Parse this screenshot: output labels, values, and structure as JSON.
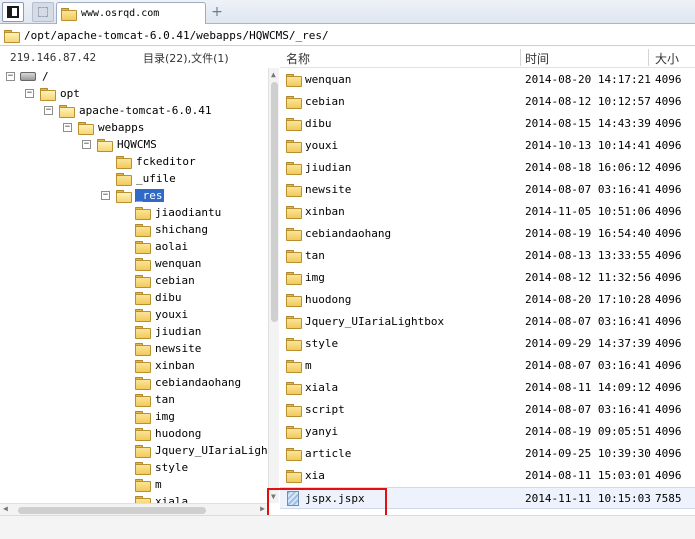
{
  "tabbar": {
    "active_tab_label": "www.osrqd.com",
    "new_tab_label": "+"
  },
  "pathbar": {
    "path": "/opt/apache-tomcat-6.0.41/webapps/HQWCMS/_res/"
  },
  "left_panel": {
    "host_ip": "219.146.87.42",
    "count_label": "目录(22),文件(1)"
  },
  "tree": {
    "root": "/",
    "opt": "opt",
    "tomcat": "apache-tomcat-6.0.41",
    "webapps": "webapps",
    "hqwcms": "HQWCMS",
    "fckeditor": "fckeditor",
    "ufile": "_ufile",
    "res": "_res",
    "res_children": [
      "jiaodiantu",
      "shichang",
      "aolai",
      "wenquan",
      "cebian",
      "dibu",
      "youxi",
      "jiudian",
      "newsite",
      "xinban",
      "cebiandaohang",
      "tan",
      "img",
      "huodong",
      "Jquery_UIariaLightb",
      "style",
      "m",
      "xiala"
    ]
  },
  "file_list": {
    "columns": {
      "name": "名称",
      "time": "时间",
      "size": "大小"
    },
    "rows": [
      {
        "name": "wenquan",
        "time": "2014-08-20 14:17:21",
        "size": "4096",
        "type": "folder"
      },
      {
        "name": "cebian",
        "time": "2014-08-12 10:12:57",
        "size": "4096",
        "type": "folder"
      },
      {
        "name": "dibu",
        "time": "2014-08-15 14:43:39",
        "size": "4096",
        "type": "folder"
      },
      {
        "name": "youxi",
        "time": "2014-10-13 10:14:41",
        "size": "4096",
        "type": "folder"
      },
      {
        "name": "jiudian",
        "time": "2014-08-18 16:06:12",
        "size": "4096",
        "type": "folder"
      },
      {
        "name": "newsite",
        "time": "2014-08-07 03:16:41",
        "size": "4096",
        "type": "folder"
      },
      {
        "name": "xinban",
        "time": "2014-11-05 10:51:06",
        "size": "4096",
        "type": "folder"
      },
      {
        "name": "cebiandaohang",
        "time": "2014-08-19 16:54:40",
        "size": "4096",
        "type": "folder"
      },
      {
        "name": "tan",
        "time": "2014-08-13 13:33:55",
        "size": "4096",
        "type": "folder"
      },
      {
        "name": "img",
        "time": "2014-08-12 11:32:56",
        "size": "4096",
        "type": "folder"
      },
      {
        "name": "huodong",
        "time": "2014-08-20 17:10:28",
        "size": "4096",
        "type": "folder"
      },
      {
        "name": "Jquery_UIariaLightbox",
        "time": "2014-08-07 03:16:41",
        "size": "4096",
        "type": "folder"
      },
      {
        "name": "style",
        "time": "2014-09-29 14:37:39",
        "size": "4096",
        "type": "folder"
      },
      {
        "name": "m",
        "time": "2014-08-07 03:16:41",
        "size": "4096",
        "type": "folder"
      },
      {
        "name": "xiala",
        "time": "2014-08-11 14:09:12",
        "size": "4096",
        "type": "folder"
      },
      {
        "name": "script",
        "time": "2014-08-07 03:16:41",
        "size": "4096",
        "type": "folder"
      },
      {
        "name": "yanyi",
        "time": "2014-08-19 09:05:51",
        "size": "4096",
        "type": "folder"
      },
      {
        "name": "article",
        "time": "2014-09-25 10:39:30",
        "size": "4096",
        "type": "folder"
      },
      {
        "name": "xia",
        "time": "2014-08-11 15:03:01",
        "size": "4096",
        "type": "folder"
      },
      {
        "name": "jspx.jspx",
        "time": "2014-11-11 10:15:03",
        "size": "7585",
        "type": "file"
      }
    ]
  },
  "colors": {
    "selection": "#3169c6",
    "highlight_box": "#e01010",
    "folder": "#f2c95a"
  }
}
